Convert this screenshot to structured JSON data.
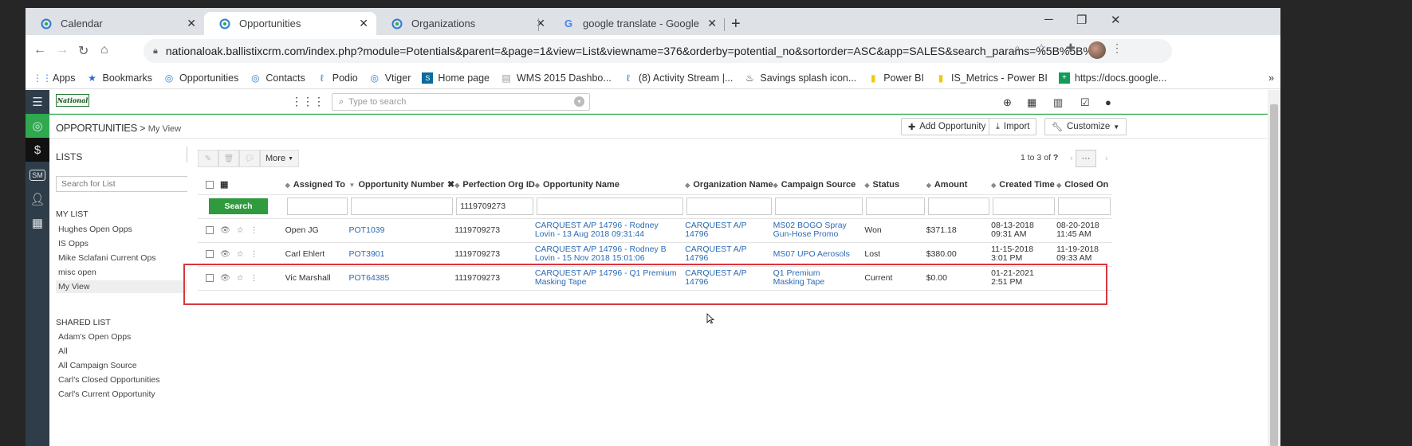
{
  "browser": {
    "tabs": [
      {
        "label": "Calendar",
        "active": false
      },
      {
        "label": "Opportunities",
        "active": true
      },
      {
        "label": "Organizations",
        "active": false
      },
      {
        "label": "google translate - Google Search",
        "active": false
      }
    ],
    "new_tab": "+",
    "window_controls": {
      "minimize": "─",
      "maximize": "❐",
      "close": "✕"
    },
    "url": "nationaloak.ballistixcrm.com/index.php?module=Potentials&parent=&page=1&view=List&viewname=376&orderby=potential_no&sortorder=ASC&app=SALES&search_params=%5B%5B%...",
    "bookmarks": [
      {
        "label": "Apps",
        "icon": "apps-grid-icon"
      },
      {
        "label": "Bookmarks",
        "icon": "star-icon"
      },
      {
        "label": "Opportunities",
        "icon": "vtiger-icon"
      },
      {
        "label": "Contacts",
        "icon": "vtiger-icon"
      },
      {
        "label": "Podio",
        "icon": "podio-icon"
      },
      {
        "label": "Vtiger",
        "icon": "vtiger-icon"
      },
      {
        "label": "Home page",
        "icon": "sharepoint-icon"
      },
      {
        "label": "WMS 2015 Dashbo...",
        "icon": "doc-icon"
      },
      {
        "label": "(8) Activity Stream |...",
        "icon": "podio-icon"
      },
      {
        "label": "Savings splash icon...",
        "icon": "splash-icon"
      },
      {
        "label": "Power BI",
        "icon": "powerbi-icon"
      },
      {
        "label": "IS_Metrics - Power BI",
        "icon": "powerbi-icon"
      },
      {
        "label": "https://docs.google...",
        "icon": "sheets-icon"
      }
    ],
    "bookmarks_more": "»"
  },
  "topbar": {
    "logo_text": "National",
    "search_placeholder": "Type to search"
  },
  "module": {
    "title": "OPPORTUNITIES",
    "separator": ">",
    "view": "My View",
    "buttons": {
      "add": "Add Opportunity",
      "import": "Import",
      "customize": "Customize"
    }
  },
  "rail": {
    "sm_label": "SM"
  },
  "sidebar": {
    "title": "LISTS",
    "add": "+",
    "search_placeholder": "Search for List",
    "my_list_title": "MY LIST",
    "my_list": [
      "Hughes Open Opps",
      "IS Opps",
      "Mike Sclafani Current Ops",
      "misc open",
      "My View"
    ],
    "shared_list_title": "SHARED LIST",
    "shared_list": [
      "Adam's Open Opps",
      "All",
      "All Campaign Source",
      "Carl's Closed Opportunities",
      "Carl's Current Opportunity"
    ]
  },
  "toolbar": {
    "more": "More",
    "pager_text": "1 to 3",
    "pager_of": "of",
    "pager_total": "?",
    "dots": "···"
  },
  "table": {
    "columns": [
      "Assigned To",
      "Opportunity Number",
      "Perfection Org ID",
      "Opportunity Name",
      "Organization Name",
      "Campaign Source",
      "Status",
      "Amount",
      "Created Time",
      "Closed On"
    ],
    "search_label": "Search",
    "filter_perfection_org_id": "1119709273",
    "rows": [
      {
        "assigned": "Open JG",
        "number": "POT1039",
        "org_id": "1119709273",
        "name_l1": "CARQUEST A/P 14796 - Rodney",
        "name_l2": "Lovin - 13 Aug 2018 09:31:44",
        "org_l1": "CARQUEST A/P",
        "org_l2": "14796",
        "camp_l1": "MS02 BOGO Spray",
        "camp_l2": "Gun-Hose Promo",
        "status": "Won",
        "amount": "$371.18",
        "created_l1": "08-13-2018",
        "created_l2": "09:31 AM",
        "closed_l1": "08-20-2018",
        "closed_l2": "11:45 AM"
      },
      {
        "assigned": "Carl Ehlert",
        "number": "POT3901",
        "org_id": "1119709273",
        "name_l1": "CARQUEST A/P 14796 - Rodney B",
        "name_l2": "Lovin - 15 Nov 2018 15:01:06",
        "org_l1": "CARQUEST A/P",
        "org_l2": "14796",
        "camp_l1": "MS07 UPO Aerosols",
        "camp_l2": "",
        "status": "Lost",
        "amount": "$380.00",
        "created_l1": "11-15-2018",
        "created_l2": "3:01 PM",
        "closed_l1": "11-19-2018",
        "closed_l2": "09:33 AM"
      },
      {
        "assigned": "Vic Marshall",
        "number": "POT64385",
        "org_id": "1119709273",
        "name_l1": "CARQUEST A/P 14796 - Q1 Premium",
        "name_l2": "Masking Tape",
        "org_l1": "CARQUEST A/P",
        "org_l2": "14796",
        "camp_l1": "Q1 Premium",
        "camp_l2": "Masking Tape",
        "status": "Current",
        "amount": "$0.00",
        "created_l1": "01-21-2021",
        "created_l2": "2:51 PM",
        "closed_l1": "",
        "closed_l2": ""
      }
    ]
  },
  "colors": {
    "accent_green": "#2fa84f",
    "link_blue": "#2b6bb5",
    "highlight_red": "#d9363e",
    "rail_dark": "#2f3d4a"
  }
}
